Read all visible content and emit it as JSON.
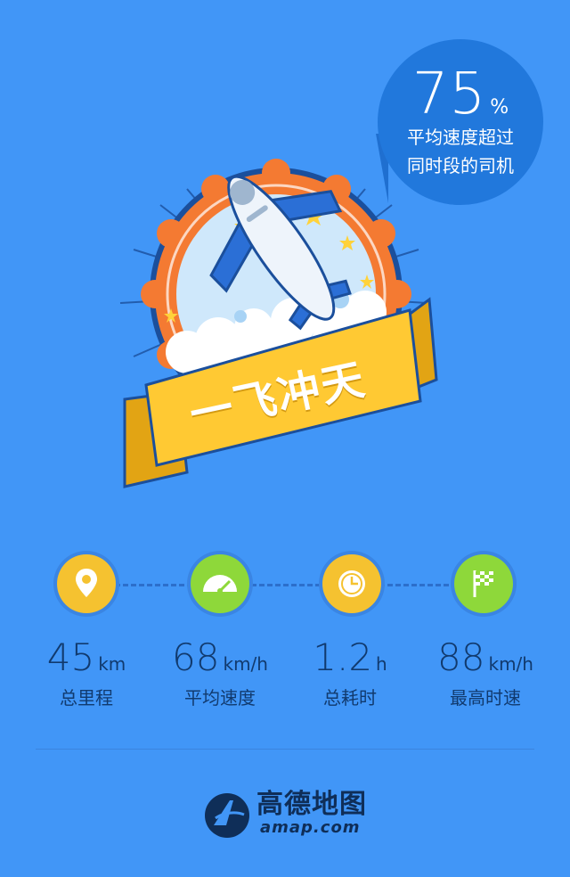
{
  "bubble": {
    "percent_value": "75",
    "percent_sign": "%",
    "line1": "平均速度超过",
    "line2": "同时段的司机"
  },
  "badge": {
    "title": "一飞冲天",
    "icon": "airplane-icon"
  },
  "stats": [
    {
      "icon": "location-pin-icon",
      "value": "45",
      "unit": "km",
      "label": "总里程",
      "color": "#f5c230"
    },
    {
      "icon": "speedometer-icon",
      "value": "68",
      "unit": "km/h",
      "label": "平均速度",
      "color": "#8ed83a"
    },
    {
      "icon": "clock-icon",
      "value": "1.2",
      "unit": "h",
      "label": "总耗时",
      "color": "#f5c230"
    },
    {
      "icon": "checkered-flag-icon",
      "value": "88",
      "unit": "km/h",
      "label": "最高时速",
      "color": "#8ed83a"
    }
  ],
  "footer": {
    "logo_cn": "高德地图",
    "logo_en": "amap.com"
  },
  "colors": {
    "background": "#4196f7",
    "bubble": "#2178dc",
    "text_dark": "#113a6e"
  }
}
